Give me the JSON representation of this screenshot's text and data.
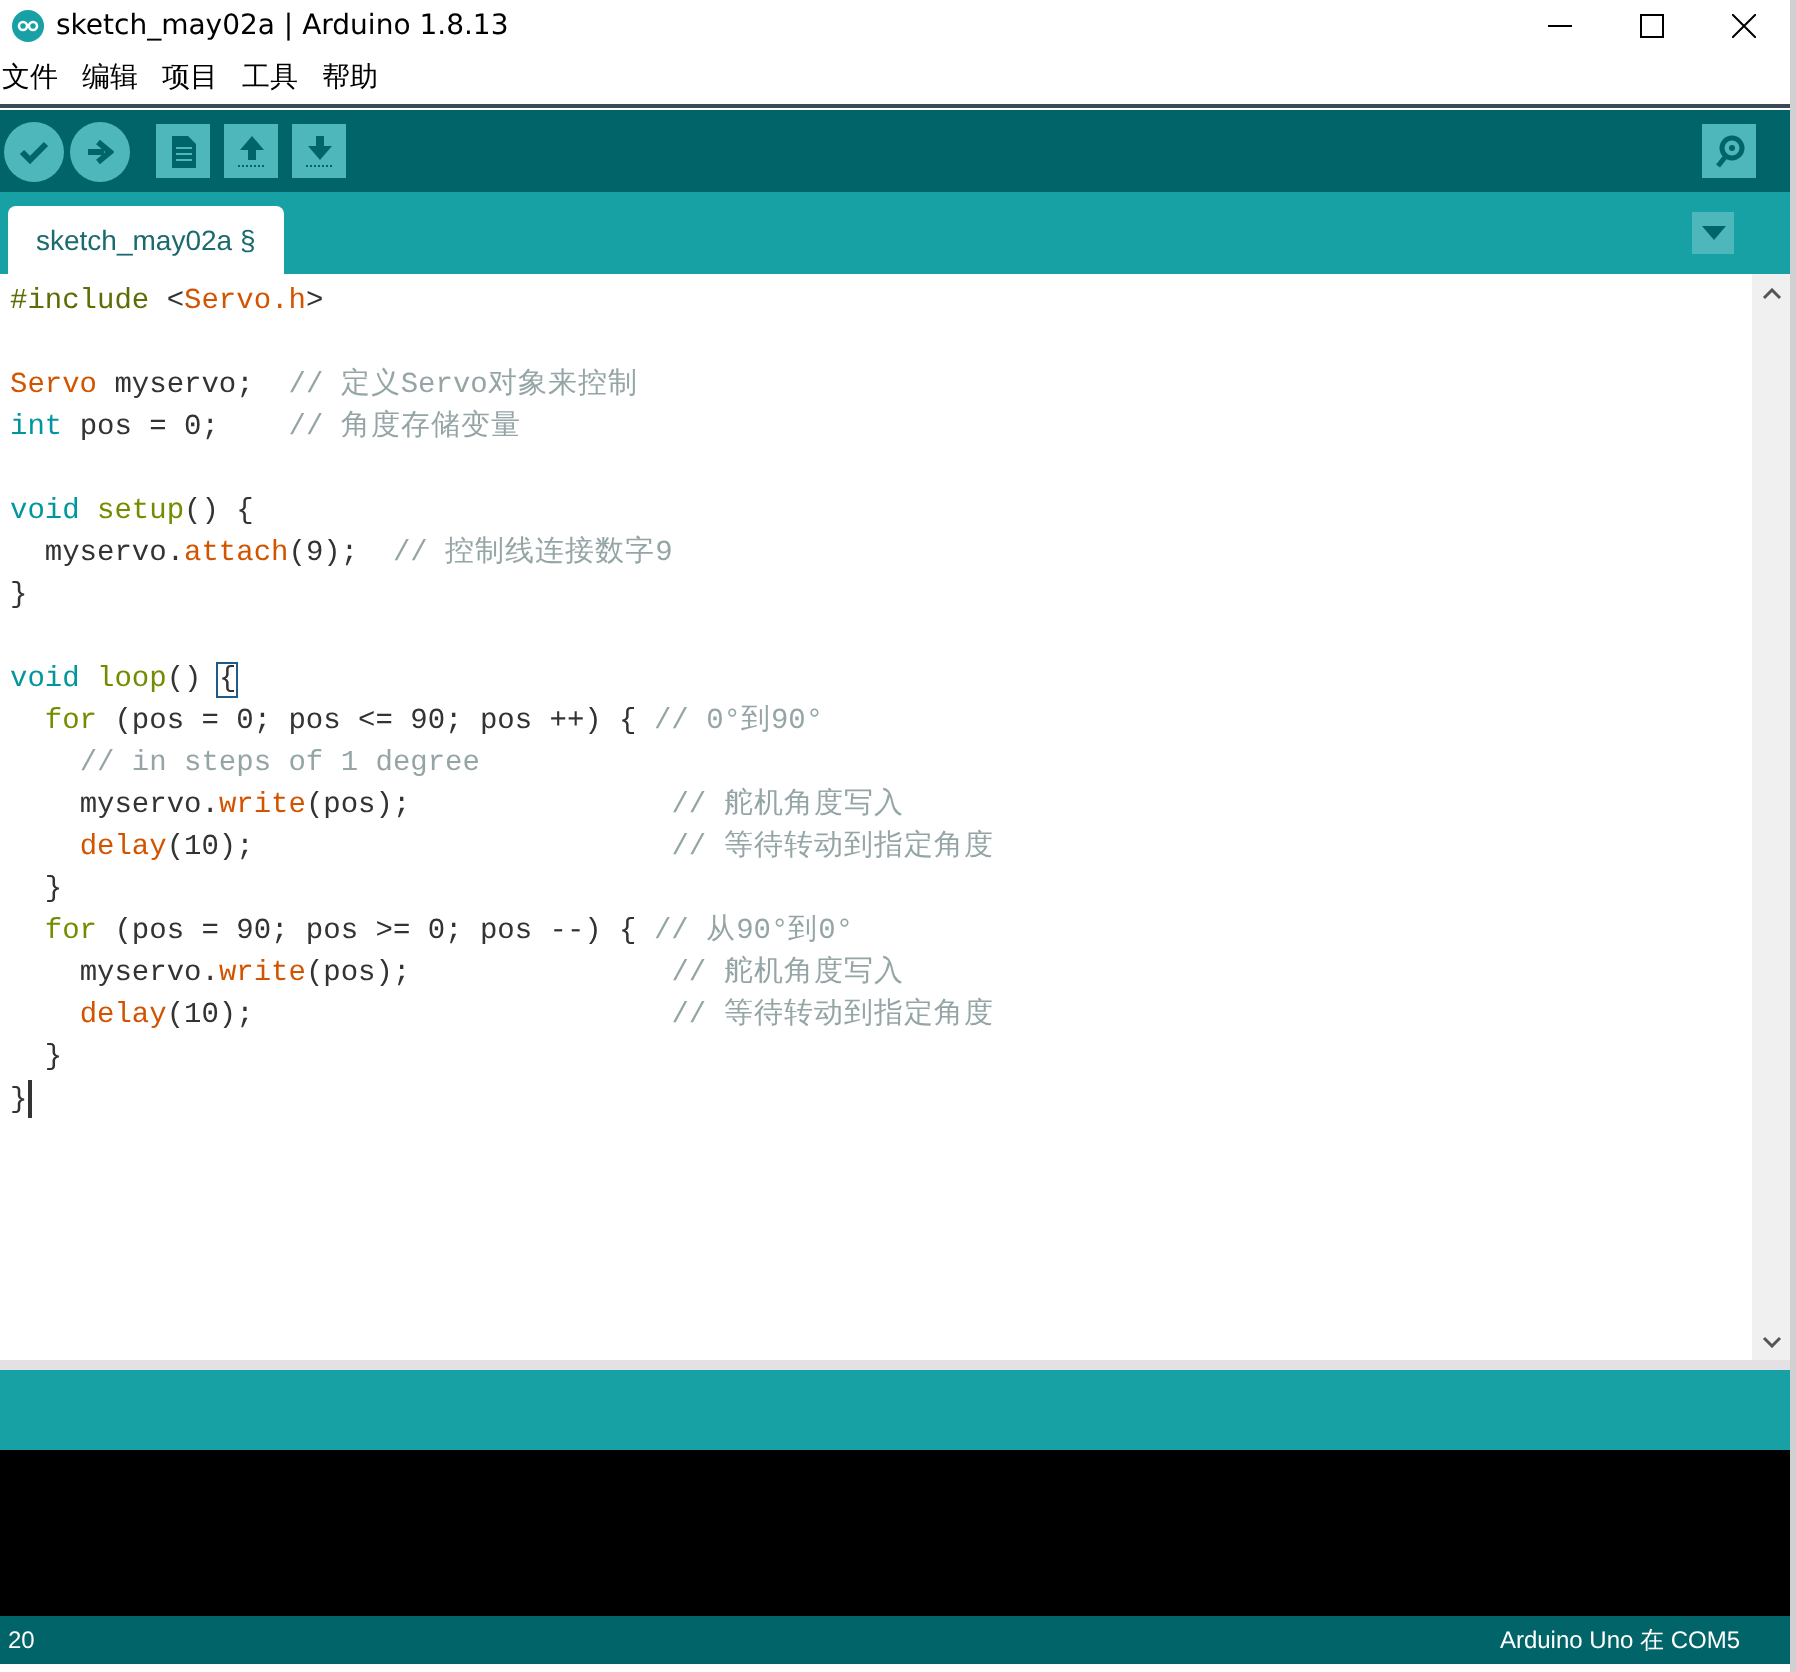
{
  "window": {
    "title": "sketch_may02a | Arduino 1.8.13"
  },
  "menu": [
    "文件",
    "编辑",
    "项目",
    "工具",
    "帮助"
  ],
  "tabs": [
    {
      "label": "sketch_may02a §",
      "selected": true
    }
  ],
  "editor": {
    "lines": [
      {
        "kind": "code",
        "caret": false,
        "tokens": [
          {
            "text": "#include",
            "kind": "preproc"
          },
          {
            "text": " <",
            "kind": "plain"
          },
          {
            "text": "Servo.h",
            "kind": "type"
          },
          {
            "text": ">",
            "kind": "plain"
          }
        ]
      },
      {
        "kind": "blank"
      },
      {
        "kind": "code",
        "caret": false,
        "tokens": [
          {
            "text": "Servo",
            "kind": "type"
          },
          {
            "text": " myservo;  ",
            "kind": "plain"
          },
          {
            "text": "// 定义Servo对象来控制",
            "kind": "comment"
          }
        ]
      },
      {
        "kind": "code",
        "caret": false,
        "tokens": [
          {
            "text": "int",
            "kind": "keyword"
          },
          {
            "text": " pos = 0;    ",
            "kind": "plain"
          },
          {
            "text": "// 角度存储变量",
            "kind": "comment"
          }
        ]
      },
      {
        "kind": "blank"
      },
      {
        "kind": "code",
        "caret": false,
        "tokens": [
          {
            "text": "void",
            "kind": "keyword"
          },
          {
            "text": " setup",
            "kind": "control"
          },
          {
            "text": "() {",
            "kind": "plain"
          }
        ]
      },
      {
        "kind": "code",
        "caret": false,
        "tokens": [
          {
            "text": "  myservo.",
            "kind": "plain"
          },
          {
            "text": "attach",
            "kind": "function"
          },
          {
            "text": "(9);  ",
            "kind": "plain"
          },
          {
            "text": "// 控制线连接数字9",
            "kind": "comment"
          }
        ]
      },
      {
        "kind": "code",
        "caret": false,
        "tokens": [
          {
            "text": "}",
            "kind": "plain"
          }
        ]
      },
      {
        "kind": "blank"
      },
      {
        "kind": "code",
        "caret": false,
        "tokens": [
          {
            "text": "void",
            "kind": "keyword"
          },
          {
            "text": " loop",
            "kind": "control"
          },
          {
            "text": "() ",
            "kind": "plain"
          },
          {
            "text": "{",
            "kind": "match"
          }
        ]
      },
      {
        "kind": "code",
        "caret": false,
        "tokens": [
          {
            "text": "  for",
            "kind": "control"
          },
          {
            "text": " (pos = 0; pos <= 90; pos ++) { ",
            "kind": "plain"
          },
          {
            "text": "// 0°到90°",
            "kind": "comment"
          }
        ]
      },
      {
        "kind": "code",
        "caret": false,
        "tokens": [
          {
            "text": "    // in steps of 1 degree",
            "kind": "comment"
          }
        ]
      },
      {
        "kind": "code",
        "caret": false,
        "tokens": [
          {
            "text": "    myservo.",
            "kind": "plain"
          },
          {
            "text": "write",
            "kind": "function"
          },
          {
            "text": "(pos);               ",
            "kind": "plain"
          },
          {
            "text": "// 舵机角度写入",
            "kind": "comment"
          }
        ]
      },
      {
        "kind": "code",
        "caret": false,
        "tokens": [
          {
            "text": "    delay",
            "kind": "function"
          },
          {
            "text": "(10);                        ",
            "kind": "plain"
          },
          {
            "text": "// 等待转动到指定角度",
            "kind": "comment"
          }
        ]
      },
      {
        "kind": "code",
        "caret": false,
        "tokens": [
          {
            "text": "  }",
            "kind": "plain"
          }
        ]
      },
      {
        "kind": "code",
        "caret": false,
        "tokens": [
          {
            "text": "  for",
            "kind": "control"
          },
          {
            "text": " (pos = 90; pos >= 0; pos --) { ",
            "kind": "plain"
          },
          {
            "text": "// 从90°到0°",
            "kind": "comment"
          }
        ]
      },
      {
        "kind": "code",
        "caret": false,
        "tokens": [
          {
            "text": "    myservo.",
            "kind": "plain"
          },
          {
            "text": "write",
            "kind": "function"
          },
          {
            "text": "(pos);               ",
            "kind": "plain"
          },
          {
            "text": "// 舵机角度写入",
            "kind": "comment"
          }
        ]
      },
      {
        "kind": "code",
        "caret": false,
        "tokens": [
          {
            "text": "    delay",
            "kind": "function"
          },
          {
            "text": "(10);                        ",
            "kind": "plain"
          },
          {
            "text": "// 等待转动到指定角度",
            "kind": "comment"
          }
        ]
      },
      {
        "kind": "code",
        "caret": false,
        "tokens": [
          {
            "text": "  }",
            "kind": "plain"
          }
        ]
      },
      {
        "kind": "code",
        "caret": true,
        "tokens": [
          {
            "text": "}",
            "kind": "plain"
          }
        ]
      }
    ]
  },
  "status_bar": {
    "line": "20",
    "board": "Arduino Uno 在 COM5"
  }
}
